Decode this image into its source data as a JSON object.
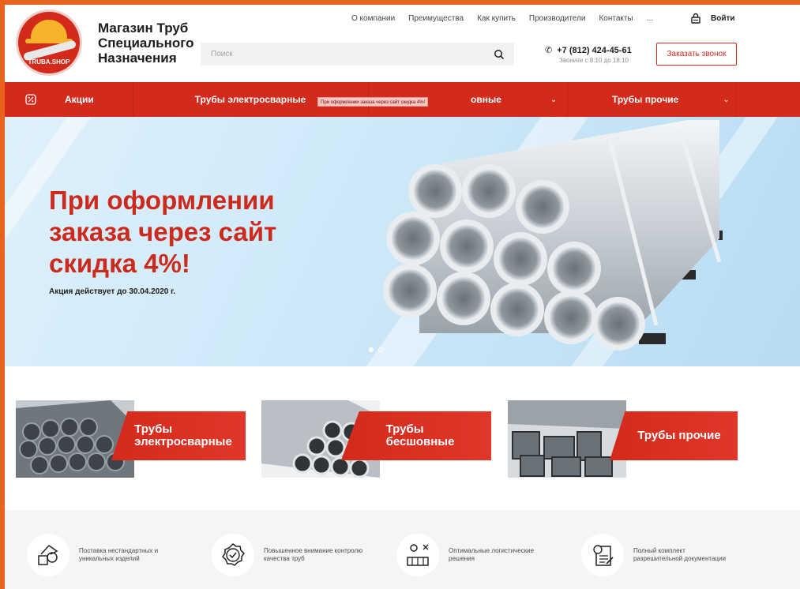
{
  "header": {
    "logo_text": "TRUBA.SHOP",
    "brand_lines": [
      "Магазин Труб",
      "Специального",
      "Назначения"
    ],
    "top_nav": [
      "О компании",
      "Преимущества",
      "Как купить",
      "Производители",
      "Контакты",
      "..."
    ],
    "login_label": "Войти",
    "search_placeholder": "Поиск",
    "phone": "+7 (812) 424-45-61",
    "phone_hours": "Звоните с 8:10 до 18:10",
    "callback_label": "Заказать звонок"
  },
  "cat_nav": {
    "items": [
      {
        "label": "Акции",
        "icon": "percent-icon"
      },
      {
        "label": "Трубы электросварные"
      },
      {
        "label": "овные"
      },
      {
        "label": "Трубы прочие"
      }
    ],
    "tooltip": "При оформлении заказа через сайт скидка 4%!"
  },
  "hero": {
    "title": "При оформлении заказа через сайт скидка 4%!",
    "subtitle": "Акция действует до 30.04.2020 г.",
    "slides_total": 2,
    "active_slide": 1
  },
  "cards": [
    {
      "title_line1": "Трубы",
      "title_line2": "электросварные"
    },
    {
      "title_line1": "Трубы",
      "title_line2": "бесшовные"
    },
    {
      "title_line1": "Трубы прочие",
      "title_line2": ""
    }
  ],
  "features": [
    {
      "text": "Поставка нестандартных и уникальных изделий",
      "icon": "custom-parts-icon"
    },
    {
      "text": "Повышенное внимание контролю качества труб",
      "icon": "quality-check-icon"
    },
    {
      "text": "Оптимальные логистические решения",
      "icon": "logistics-icon"
    },
    {
      "text": "Полный комплект разрешительной документации",
      "icon": "documents-icon"
    }
  ],
  "colors": {
    "brand_red": "#d42a1c",
    "frame_orange": "#e8641c",
    "hero_blue": "#cde8f8"
  }
}
